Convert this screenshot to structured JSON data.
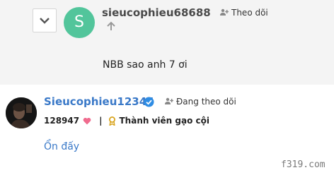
{
  "post1": {
    "username": "sieucophieu68688",
    "follow_label": "Theo dõi",
    "comment": "NBB sao anh 7 ơi",
    "avatar_letter": "S"
  },
  "post2": {
    "username": "Sieucophieu12345",
    "follow_label": "Đang theo dõi",
    "likes": "128947",
    "rank": "Thành viên gạo cội",
    "comment": "Ổn đấy"
  },
  "watermark": "f319.com",
  "colors": {
    "avatar_green": "#52c59b",
    "link_blue": "#3a79c8",
    "heart_pink": "#f06b8e",
    "medal_gold": "#d9a520",
    "verified_blue": "#2f8de4"
  }
}
